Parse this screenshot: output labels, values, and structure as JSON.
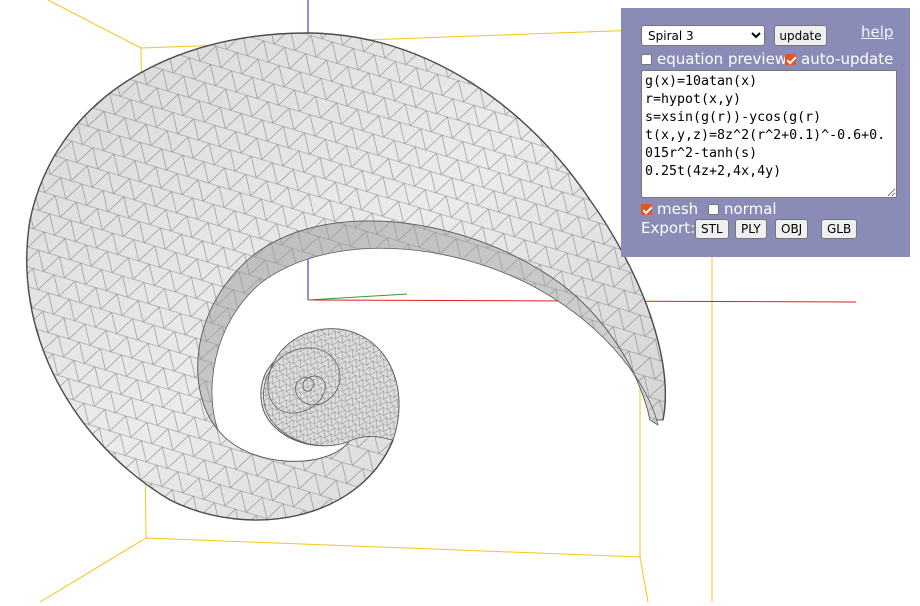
{
  "panel": {
    "preset": {
      "selected": "Spiral 3",
      "options": [
        "Spiral 3"
      ]
    },
    "update_label": "update",
    "help_label": "help",
    "equation_preview_label": "equation preview",
    "equation_preview_checked": false,
    "auto_update_label": "auto-update",
    "auto_update_checked": true,
    "equation_text": "g(x)=10atan(x)\nr=hypot(x,y)\ns=xsin(g(r))-ycos(g(r)\nt(x,y,z)=8z^2(r^2+0.1)^-0.6+0.015r^2-tanh(s)\n0.25t(4z+2,4x,4y)",
    "mesh_label": "mesh",
    "mesh_checked": true,
    "normal_label": "normal",
    "normal_checked": false,
    "export_label": "Export:",
    "export_buttons": [
      "STL",
      "PLY",
      "OBJ",
      "GLB"
    ]
  },
  "viewport": {
    "colors": {
      "bounding_box": "#f5c518",
      "axis_x": "#e02020",
      "axis_y": "#2ca02c",
      "axis_z": "#2222cc",
      "surface": "#e4e4e4",
      "mesh_line": "#6a6a6a"
    }
  }
}
